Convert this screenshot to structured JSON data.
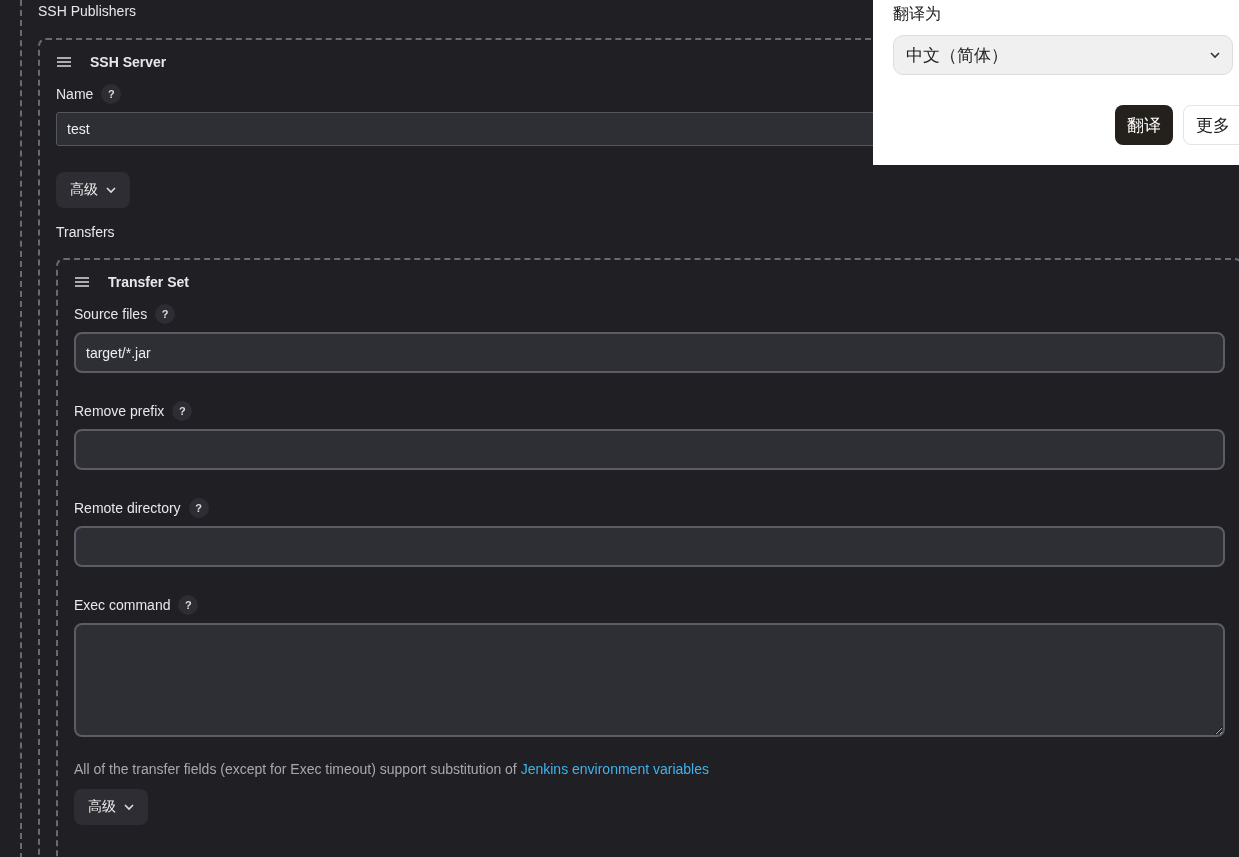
{
  "section_title": "SSH Publishers",
  "server": {
    "title": "SSH Server",
    "name_label": "Name",
    "help": "?",
    "name_value": "test",
    "advanced_button": "高级",
    "transfers_label": "Transfers"
  },
  "transfer_set": {
    "title": "Transfer Set",
    "fields": [
      {
        "kind": "input",
        "label": "Source files",
        "help": "?",
        "value": "target/*.jar"
      },
      {
        "kind": "input",
        "label": "Remove prefix",
        "help": "?"
      },
      {
        "kind": "input",
        "label": "Remote directory",
        "help": "?"
      },
      {
        "kind": "textarea",
        "label": "Exec command",
        "help": "?"
      }
    ],
    "note": "All of the transfer fields (except for Exec timeout) support substitution of ",
    "note_link": "Jenkins environment variables",
    "advanced_button": "高级"
  },
  "translate_popup": {
    "label": "翻译为",
    "language": "中文（简体）",
    "translate_button": "翻译",
    "more_button": "更多"
  }
}
